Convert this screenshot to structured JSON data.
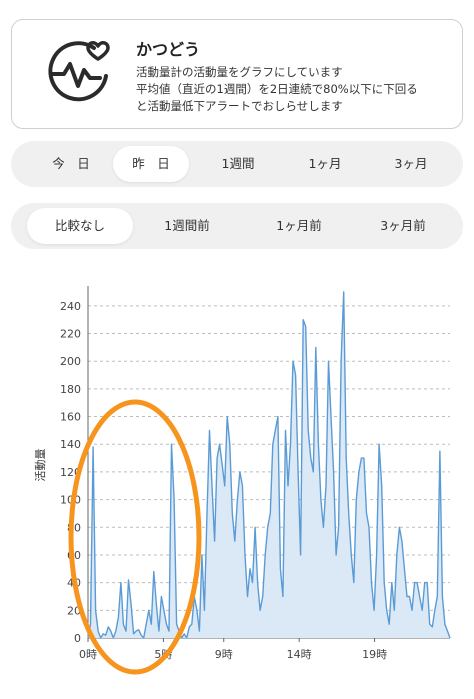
{
  "info": {
    "title": "かつどう",
    "desc1": "活動量計の活動量をグラフにしています",
    "desc2": "平均値（直近の1週間）を2日連続で80%以下に下回る",
    "desc3": "と活動量低下アラートでおしらせします"
  },
  "period_tabs": [
    {
      "label": "今　日",
      "active": false
    },
    {
      "label": "昨　日",
      "active": true
    },
    {
      "label": "1週間",
      "active": false
    },
    {
      "label": "1ヶ月",
      "active": false
    },
    {
      "label": "3ヶ月",
      "active": false
    }
  ],
  "compare_tabs": [
    {
      "label": "比較なし",
      "active": true
    },
    {
      "label": "1週間前",
      "active": false
    },
    {
      "label": "1ヶ月前",
      "active": false
    },
    {
      "label": "3ヶ月前",
      "active": false
    }
  ],
  "colors": {
    "line": "#5b9bd5",
    "fill": "#dbe9f7",
    "highlight": "#f7941d",
    "grid": "#bdbdbd"
  },
  "chart_data": {
    "type": "area",
    "ylabel": "活動量",
    "ylim": [
      0,
      250
    ],
    "yticks": [
      "0",
      "20",
      "40",
      "60",
      "80",
      "100",
      "120",
      "140",
      "160",
      "180",
      "200",
      "220",
      "240"
    ],
    "xticks": [
      {
        "label": "0時",
        "hour": 0
      },
      {
        "label": "5時",
        "hour": 5
      },
      {
        "label": "9時",
        "hour": 9
      },
      {
        "label": "14時",
        "hour": 14
      },
      {
        "label": "19時",
        "hour": 19
      }
    ],
    "grid": true,
    "legend": "none",
    "x_range_hours": [
      0,
      24
    ],
    "values": [
      0,
      10,
      138,
      20,
      5,
      0,
      3,
      2,
      8,
      5,
      0,
      5,
      15,
      40,
      10,
      5,
      42,
      25,
      3,
      5,
      6,
      2,
      0,
      10,
      20,
      10,
      48,
      25,
      5,
      30,
      20,
      10,
      5,
      140,
      100,
      10,
      5,
      0,
      3,
      0,
      8,
      10,
      30,
      20,
      5,
      60,
      20,
      90,
      150,
      110,
      70,
      130,
      140,
      125,
      110,
      160,
      140,
      90,
      70,
      100,
      120,
      110,
      60,
      30,
      50,
      40,
      80,
      40,
      20,
      30,
      60,
      80,
      90,
      140,
      150,
      160,
      50,
      30,
      150,
      110,
      140,
      200,
      190,
      120,
      60,
      230,
      225,
      150,
      130,
      120,
      210,
      140,
      100,
      80,
      110,
      200,
      160,
      120,
      60,
      80,
      200,
      250,
      130,
      90,
      60,
      40,
      100,
      120,
      130,
      130,
      90,
      80,
      40,
      20,
      60,
      140,
      110,
      40,
      20,
      10,
      40,
      20,
      60,
      80,
      70,
      50,
      30,
      30,
      20,
      40,
      40,
      30,
      20,
      40,
      40,
      10,
      8,
      20,
      30,
      135,
      30,
      10,
      5,
      0
    ]
  }
}
